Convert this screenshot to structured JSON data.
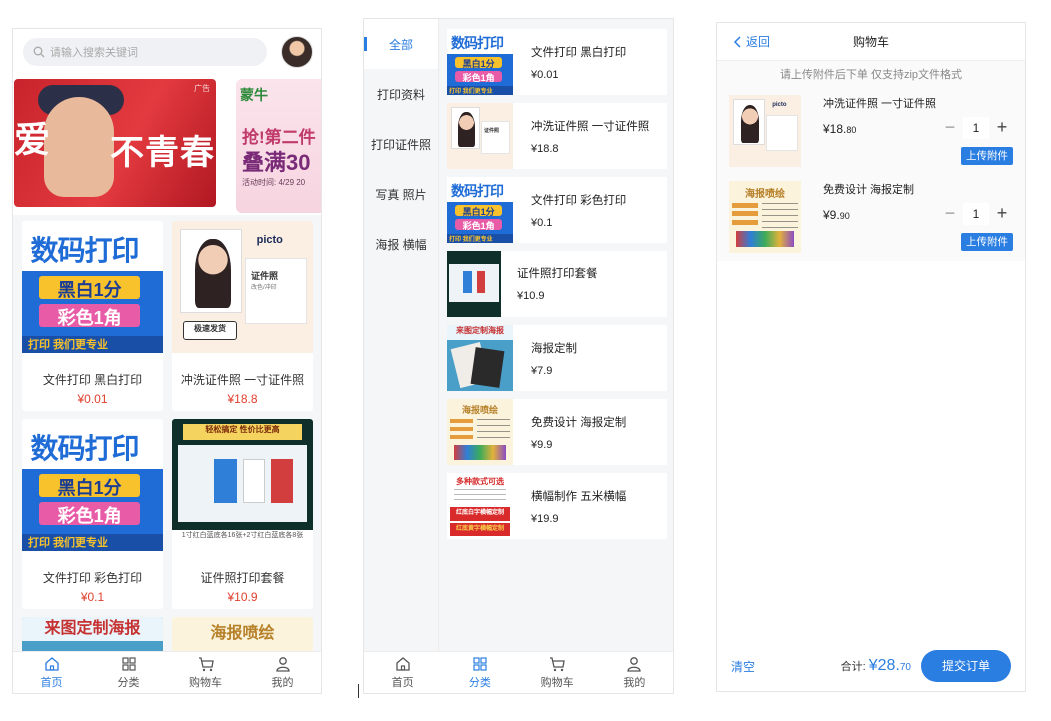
{
  "colors": {
    "accent": "#2a7de1",
    "price_red": "#e0402f"
  },
  "home": {
    "search_placeholder": "请输入搜索关键词",
    "banner1": {
      "tag": "广告",
      "line1": "爱",
      "line2": "不青春"
    },
    "banner2": {
      "brand": "蒙牛",
      "line1": "抢!第二件",
      "line2": "叠满30",
      "line3": "活动时间: 4/29 20"
    },
    "products": [
      {
        "name": "文件打印 黑白打印",
        "price": "¥0.01"
      },
      {
        "name": "冲洗证件照 一寸证件照",
        "price": "¥18.8"
      },
      {
        "name": "文件打印 彩色打印",
        "price": "¥0.1"
      },
      {
        "name": "证件照打印套餐",
        "price": "¥10.9"
      }
    ],
    "partial_cards": [
      {
        "text": "来图定制海报"
      },
      {
        "text": "海报喷绘"
      }
    ]
  },
  "thumb_text": {
    "digital_title": "数码打印",
    "digital_b1": "黑白1分",
    "digital_b2": "彩色1角",
    "digital_b3": "打印 我们更专业",
    "id_logo": "picto",
    "id_label": "证件照",
    "id_sub": "改色/冲印",
    "id_badge": "极速发货",
    "pack_top": "轻松搞定 性价比更高",
    "pack_foot": "1寸红白蓝底各16张+2寸红白蓝底各8张",
    "poster_title": "来图定制海报",
    "pen_title": "海报喷绘",
    "banner_title": "多种款式可选",
    "banner_r1": "红底白字横幅定制",
    "banner_r2": "红底黄字横幅定制"
  },
  "tabbar": [
    {
      "label": "首页",
      "icon": "home-icon"
    },
    {
      "label": "分类",
      "icon": "grid-icon"
    },
    {
      "label": "购物车",
      "icon": "cart-icon"
    },
    {
      "label": "我的",
      "icon": "user-icon"
    }
  ],
  "category": {
    "sidebar": [
      "全部",
      "打印资料",
      "打印证件照",
      "写真 照片",
      "海报 横幅"
    ],
    "items": [
      {
        "name": "文件打印 黑白打印",
        "price": "¥0.01"
      },
      {
        "name": "冲洗证件照 一寸证件照",
        "price": "¥18.8"
      },
      {
        "name": "文件打印 彩色打印",
        "price": "¥0.1"
      },
      {
        "name": "证件照打印套餐",
        "price": "¥10.9"
      },
      {
        "name": "海报定制",
        "price": "¥7.9"
      },
      {
        "name": "免费设计 海报定制",
        "price": "¥9.9"
      },
      {
        "name": "横幅制作 五米横幅",
        "price": "¥19.9"
      }
    ]
  },
  "cart": {
    "back": "返回",
    "title": "购物车",
    "notice": "请上传附件后下单 仅支持zip文件格式",
    "items": [
      {
        "name": "冲洗证件照 一寸证件照",
        "price_int": "¥18.",
        "price_dec": "80",
        "qty": "1",
        "upload": "上传附件"
      },
      {
        "name": "免费设计 海报定制",
        "price_int": "¥9.",
        "price_dec": "90",
        "qty": "1",
        "upload": "上传附件"
      }
    ],
    "clear": "清空",
    "total_label": "合计:",
    "total_int": "¥28.",
    "total_dec": "70",
    "submit": "提交订单"
  }
}
